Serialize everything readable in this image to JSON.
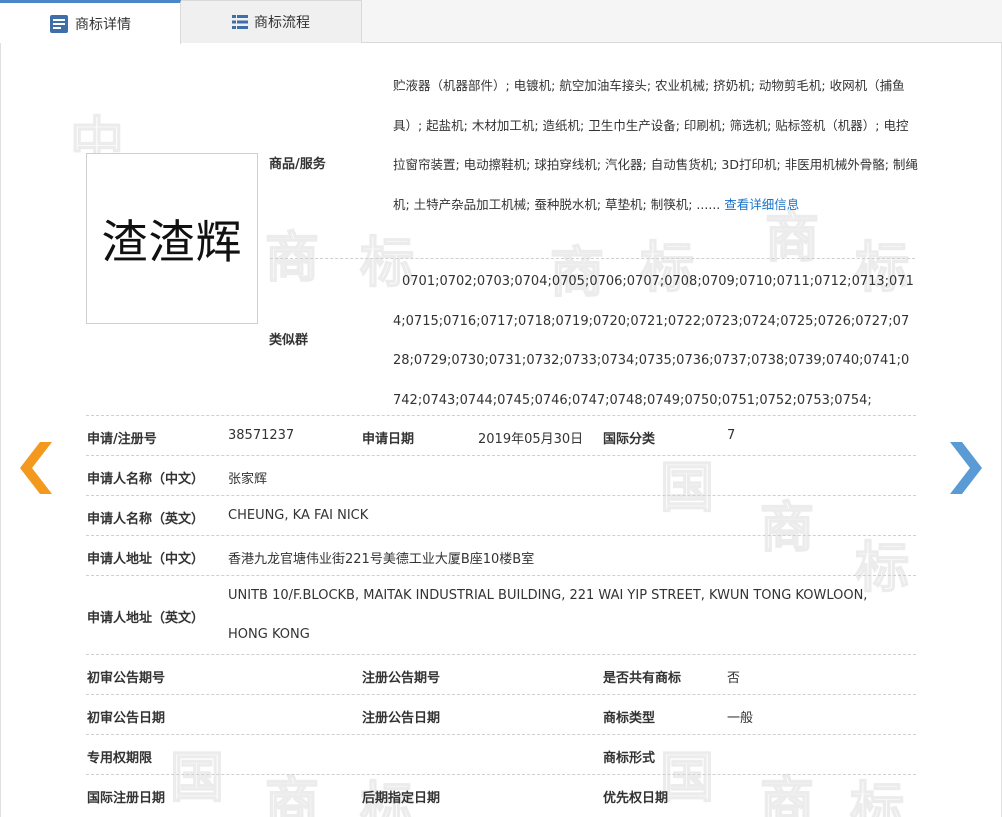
{
  "tabs": [
    {
      "label": "商标详情"
    },
    {
      "label": "商标流程"
    }
  ],
  "mark": {
    "logo_text": "渣渣辉"
  },
  "goods_services": {
    "label": "商品/服务",
    "text": "贮液器（机器部件）; 电镀机; 航空加油车接头; 农业机械; 挤奶机; 动物剪毛机; 收网机（捕鱼具）; 起盐机; 木材加工机; 造纸机; 卫生巾生产设备; 印刷机; 筛选机; 贴标签机（机器）; 电控拉窗帘装置; 电动擦鞋机; 球拍穿线机; 汽化器; 自动售货机; 3D打印机; 非医用机械外骨骼; 制绳机; 土特产杂品加工机械; 蚕种脱水机; 草垫机; 制筷机; ......",
    "more_link": "查看详细信息"
  },
  "similar_groups": {
    "label": "类似群",
    "text": "0701;0702;0703;0704;0705;0706;0707;0708;0709;0710;0711;0712;0713;0714;0715;0716;0717;0718;0719;0720;0721;0722;0723;0724;0725;0726;0727;0728;0729;0730;0731;0732;0733;0734;0735;0736;0737;0738;0739;0740;0741;0742;0743;0744;0745;0746;0747;0748;0749;0750;0751;0752;0753;0754;"
  },
  "details": {
    "reg_no_label": "申请/注册号",
    "reg_no": "38571237",
    "app_date_label": "申请日期",
    "app_date": "2019年05月30日",
    "intl_class_label": "国际分类",
    "intl_class": "7",
    "applicant_cn_label": "申请人名称（中文）",
    "applicant_cn": "张家辉",
    "applicant_en_label": "申请人名称（英文）",
    "applicant_en": "CHEUNG, KA FAI NICK",
    "address_cn_label": "申请人地址（中文）",
    "address_cn": "香港九龙官塘伟业街221号美德工业大厦B座10楼B室",
    "address_en_label": "申请人地址（英文）",
    "address_en_line1": "UNITB 10/F.BLOCKB, MAITAK INDUSTRIAL BUILDING, 221 WAI YIP STREET, KWUN TONG KOWLOON,",
    "address_en_line2": "HONG KONG",
    "prelim_pub_no_label": "初审公告期号",
    "reg_pub_no_label": "注册公告期号",
    "shared_label": "是否共有商标",
    "shared": "否",
    "prelim_pub_date_label": "初审公告日期",
    "reg_pub_date_label": "注册公告日期",
    "mark_type_label": "商标类型",
    "mark_type": "一般",
    "exclusive_period_label": "专用权期限",
    "mark_form_label": "商标形式",
    "intl_reg_date_label": "国际注册日期",
    "later_designation_label": "后期指定日期",
    "priority_date_label": "优先权日期"
  },
  "colors": {
    "accent": "#4a86c8",
    "link": "#1a73c9",
    "prev_arrow": "#f39a1e",
    "next_arrow": "#5a9bd5"
  },
  "icons": {
    "detail_tab": "document-list-icon",
    "flow_tab": "list-icon",
    "prev": "chevron-left-icon",
    "next": "chevron-right-icon"
  },
  "watermark": {
    "chars": [
      "商",
      "标",
      "中",
      "国"
    ]
  }
}
